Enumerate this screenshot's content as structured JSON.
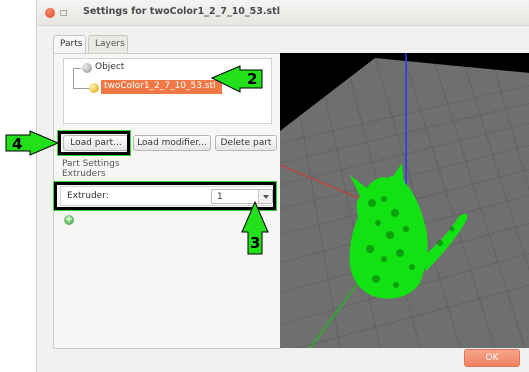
{
  "window": {
    "title": "Settings for twoColor1_2_7_10_53.stl"
  },
  "tabs": [
    {
      "label": "Parts",
      "active": true
    },
    {
      "label": "Layers",
      "active": false
    }
  ],
  "tree": {
    "root_label": "Object",
    "part_label": "twoColor1_2_7_10_53.stl"
  },
  "buttons": {
    "load_part": "Load part...",
    "load_modifier": "Load modifier...",
    "delete_part": "Delete part",
    "ok": "OK"
  },
  "settings": {
    "section_title": "Part Settings",
    "section_sub": "Extruders",
    "extruder_label": "Extruder:",
    "extruder_value": "1"
  },
  "annotations": [
    {
      "number": "2",
      "target": "part-row"
    },
    {
      "number": "3",
      "target": "extruder-select"
    },
    {
      "number": "4",
      "target": "load-part-button"
    }
  ],
  "colors": {
    "selection": "#f07746",
    "callout_green": "#22e01a",
    "model_green": "#12e212",
    "ok_button": "#f08a68"
  }
}
